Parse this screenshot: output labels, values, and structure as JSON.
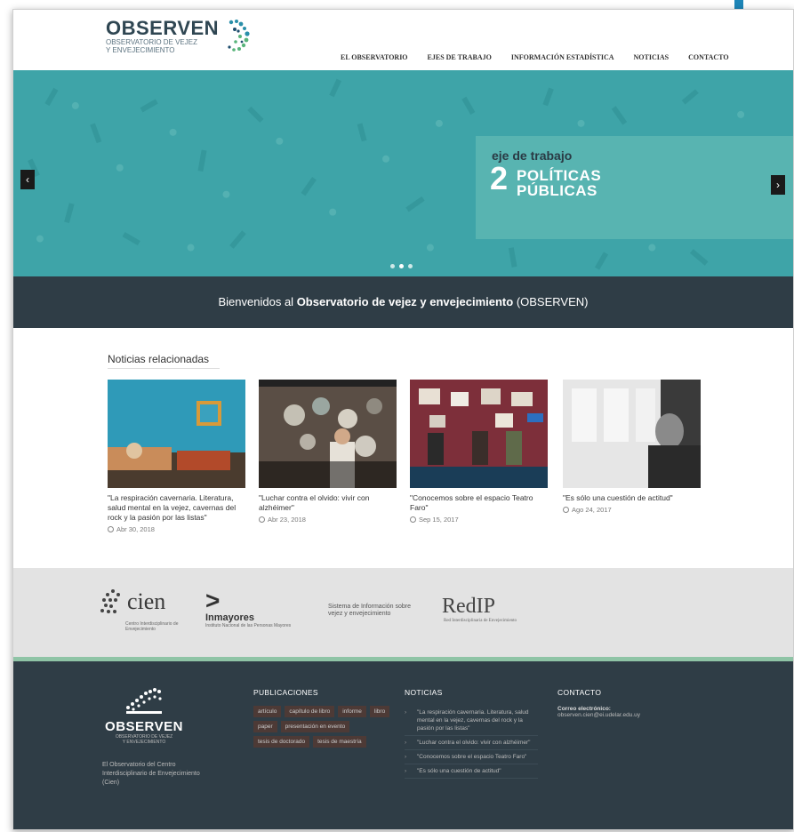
{
  "brand": {
    "name": "OBSERVEN",
    "tagline_line1": "OBSERVATORIO DE VEJEZ",
    "tagline_line2": "Y ENVEJECIMIENTO"
  },
  "nav": [
    {
      "label": "EL OBSERVATORIO"
    },
    {
      "label": "EJES DE TRABAJO"
    },
    {
      "label": "INFORMACIÓN ESTADÍSTICA"
    },
    {
      "label": "NOTICIAS"
    },
    {
      "label": "CONTACTO"
    }
  ],
  "hero": {
    "kicker": "eje de trabajo",
    "number": "2",
    "title_line1": "POLÍTICAS",
    "title_line2": "PÚBLICAS",
    "prev_icon": "chevron-left-icon",
    "next_icon": "chevron-right-icon",
    "slides": 3,
    "active_slide": 2,
    "color": "#3ea4a8"
  },
  "welcome": {
    "prefix": "Bienvenidos al",
    "bold": "Observatorio de vejez y envejecimiento",
    "suffix": "(OBSERVEN)"
  },
  "news": {
    "title": "Noticias relacionadas",
    "items": [
      {
        "caption": "\"La respiración cavernaria. Literatura, salud mental en la vejez, cavernas del rock y la pasión por las listas\"",
        "date": "Abr 30, 2018"
      },
      {
        "caption": "\"Luchar contra el olvido: vivir con alzhéimer\"",
        "date": "Abr 23, 2018"
      },
      {
        "caption": "\"Conocemos sobre el espacio Teatro Faro\"",
        "date": "Sep 15, 2017"
      },
      {
        "caption": "\"Es sólo una cuestión de actitud\"",
        "date": "Ago 24, 2017"
      }
    ]
  },
  "partners": {
    "cien": {
      "name": "cien",
      "sub": "Centro Interdisciplinario de Envejecimiento"
    },
    "inmayores": {
      "name": "Inmayores",
      "sub": "Instituto Nacional de las Personas Mayores"
    },
    "sistema": {
      "text": "Sistema de Información sobre vejez y envejecimiento"
    },
    "redip": {
      "name": "RedIP",
      "sub": "Red Interdisciplinaria de Envejecimiento"
    }
  },
  "footer": {
    "brand_name": "OBSERVEN",
    "brand_tag1": "OBSERVATORIO DE VEJEZ",
    "brand_tag2": "Y ENVEJECIMIENTO",
    "description": "El Observatorio del Centro Interdisciplinario de Envejecimiento (Cien)",
    "publicaciones": {
      "heading": "PUBLICACIONES",
      "tags": [
        "artículo",
        "capítulo de libro",
        "informe",
        "libro",
        "paper",
        "presentación en evento",
        "tesis de doctorado",
        "tesis de maestría"
      ]
    },
    "noticias": {
      "heading": "NOTICIAS",
      "items": [
        "\"La respiración cavernaria. Literatura, salud mental en la vejez, cavernas del rock y la pasión por las listas\"",
        "\"Luchar contra el olvido: vivir con alzhéimer\"",
        "\"Conocemos sobre el espacio Teatro Faro\"",
        "\"Es sólo una cuestión de actitud\""
      ]
    },
    "contacto": {
      "heading": "CONTACTO",
      "label": "Correo electrónico:",
      "email": "observen.cien@ei.udelar.edu.uy"
    }
  }
}
